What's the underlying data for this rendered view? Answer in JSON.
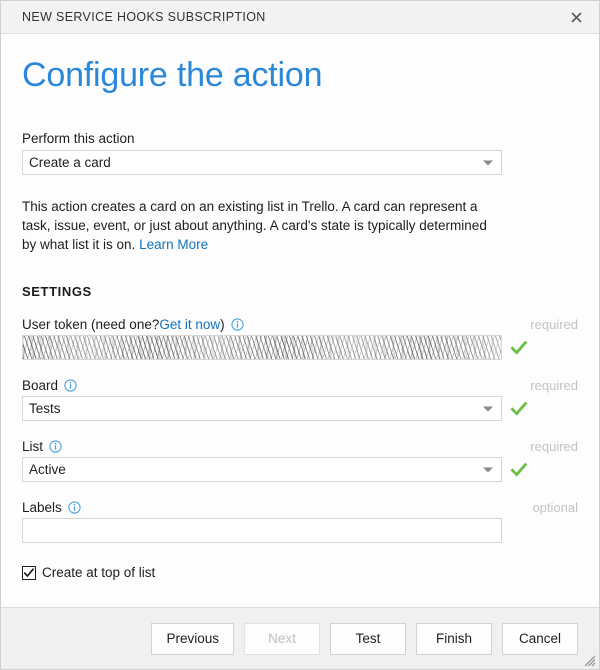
{
  "window": {
    "title": "NEW SERVICE HOOKS SUBSCRIPTION",
    "close_icon": "close-icon",
    "resize_grip_icon": "resize-grip-icon"
  },
  "page": {
    "heading": "Configure the action"
  },
  "action": {
    "label": "Perform this action",
    "selected": "Create a card",
    "dropdown_icon": "chevron-down-icon"
  },
  "description": {
    "text": "This action creates a card on an existing list in Trello. A card can represent a task, issue, event, or just about anything. A card's state is typically determined by what list it is on.",
    "link_label": "Learn More"
  },
  "settings": {
    "heading": "SETTINGS",
    "fields": [
      {
        "name": "user-token",
        "label_prefix": "User token (need one? ",
        "link_label": "Get it now",
        "label_suffix": ")",
        "info_icon": "info-icon",
        "requirement": "required",
        "type": "redacted-text",
        "value": "",
        "placeholder": "",
        "valid_icon": "green-check-icon",
        "valid": true
      },
      {
        "name": "board",
        "label_prefix": "Board",
        "link_label": "",
        "label_suffix": "",
        "info_icon": "info-icon",
        "requirement": "required",
        "type": "select",
        "value": "Tests",
        "dropdown_icon": "chevron-down-icon",
        "valid_icon": "green-check-icon",
        "valid": true
      },
      {
        "name": "list",
        "label_prefix": "List",
        "link_label": "",
        "label_suffix": "",
        "info_icon": "info-icon",
        "requirement": "required",
        "type": "select",
        "value": "Active",
        "dropdown_icon": "chevron-down-icon",
        "valid_icon": "green-check-icon",
        "valid": true
      },
      {
        "name": "labels",
        "label_prefix": "Labels",
        "link_label": "",
        "label_suffix": "",
        "info_icon": "info-icon",
        "requirement": "optional",
        "type": "text",
        "value": "",
        "placeholder": "",
        "valid": false
      }
    ],
    "checkbox": {
      "label": "Create at top of list",
      "checked": true
    }
  },
  "footer": {
    "buttons": [
      {
        "label": "Previous",
        "disabled": false
      },
      {
        "label": "Next",
        "disabled": true
      },
      {
        "label": "Test",
        "disabled": false
      },
      {
        "label": "Finish",
        "disabled": false
      },
      {
        "label": "Cancel",
        "disabled": false
      }
    ]
  },
  "colors": {
    "heading_blue": "#2b88d8",
    "link_blue": "#0f74bd",
    "info_blue": "#4aa3e0",
    "check_green": "#6cbe45",
    "required_gray": "#c3c3c3",
    "titlebar_bg": "#f2f2f2",
    "footer_bg": "#f0f0f0"
  }
}
